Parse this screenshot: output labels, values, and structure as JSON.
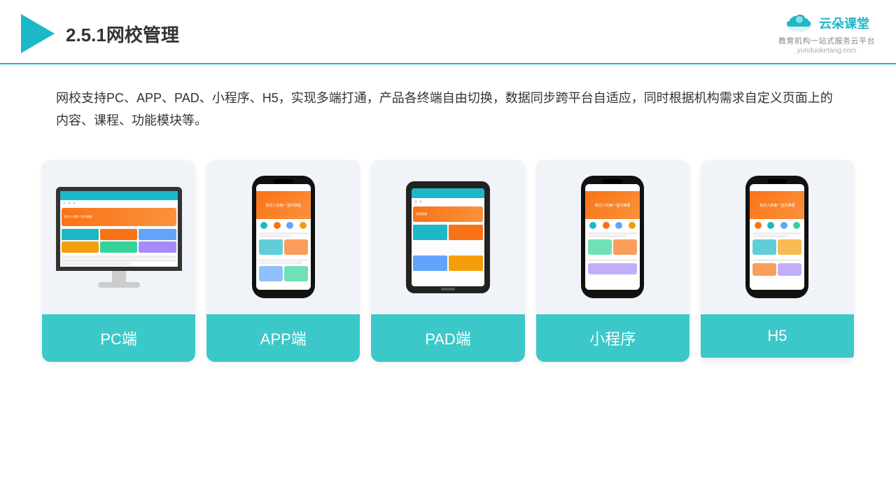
{
  "header": {
    "title": "2.5.1网校管理",
    "brand_name": "云朵课堂",
    "brand_url": "yunduoketang.com",
    "brand_slogan": "教育机构一站式服务云平台"
  },
  "description": {
    "text": "网校支持PC、APP、PAD、小程序、H5，实现多端打通，产品各终端自由切换，数据同步跨平台自适应，同时根据机构需求自定义页面上的内容、课程、功能模块等。"
  },
  "cards": [
    {
      "id": "pc",
      "label": "PC端"
    },
    {
      "id": "app",
      "label": "APP端"
    },
    {
      "id": "pad",
      "label": "PAD端"
    },
    {
      "id": "miniprogram",
      "label": "小程序"
    },
    {
      "id": "h5",
      "label": "H5"
    }
  ],
  "accent_color": "#3cc8c8",
  "title_color": "#333333"
}
